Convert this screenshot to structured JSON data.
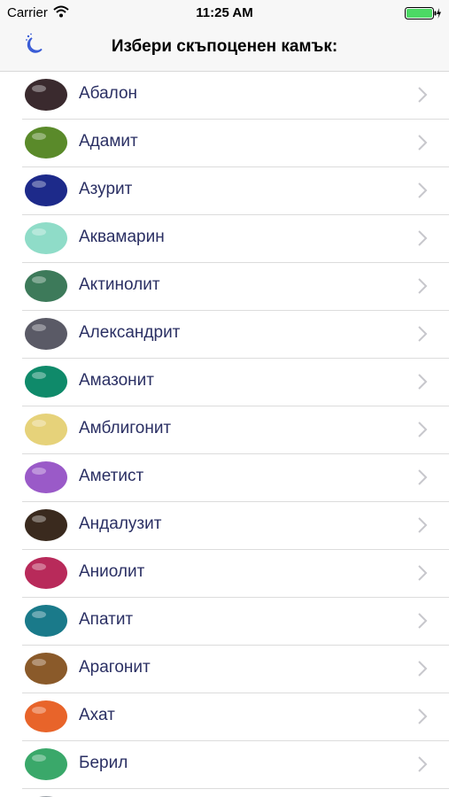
{
  "status_bar": {
    "carrier": "Carrier",
    "time": "11:25 AM",
    "battery_color": "#4cd964"
  },
  "nav": {
    "title": "Избери скъпоценен камък:",
    "night_icon": "moon-stars-icon",
    "accent": "#3a5cd6"
  },
  "gems": [
    {
      "name": "Абалон",
      "color": "#3a2a2e"
    },
    {
      "name": "Адамит",
      "color": "#5a8a2a"
    },
    {
      "name": "Азурит",
      "color": "#1d2a8a"
    },
    {
      "name": "Аквамарин",
      "color": "#8fdcc8"
    },
    {
      "name": "Актинолит",
      "color": "#3d7a5a"
    },
    {
      "name": "Александрит",
      "color": "#5a5a66"
    },
    {
      "name": "Амазонит",
      "color": "#0f8a6a"
    },
    {
      "name": "Амблигонит",
      "color": "#e6d27a"
    },
    {
      "name": "Аметист",
      "color": "#9a5ac8"
    },
    {
      "name": "Андалузит",
      "color": "#3a2a1e"
    },
    {
      "name": "Аниолит",
      "color": "#b82a5a"
    },
    {
      "name": "Апатит",
      "color": "#1a7a8a"
    },
    {
      "name": "Арагонит",
      "color": "#8a5a2a"
    },
    {
      "name": "Ахат",
      "color": "#e8642a"
    },
    {
      "name": "Берил",
      "color": "#3aa86a"
    },
    {
      "name": "",
      "color": "#9aa0a6"
    }
  ]
}
